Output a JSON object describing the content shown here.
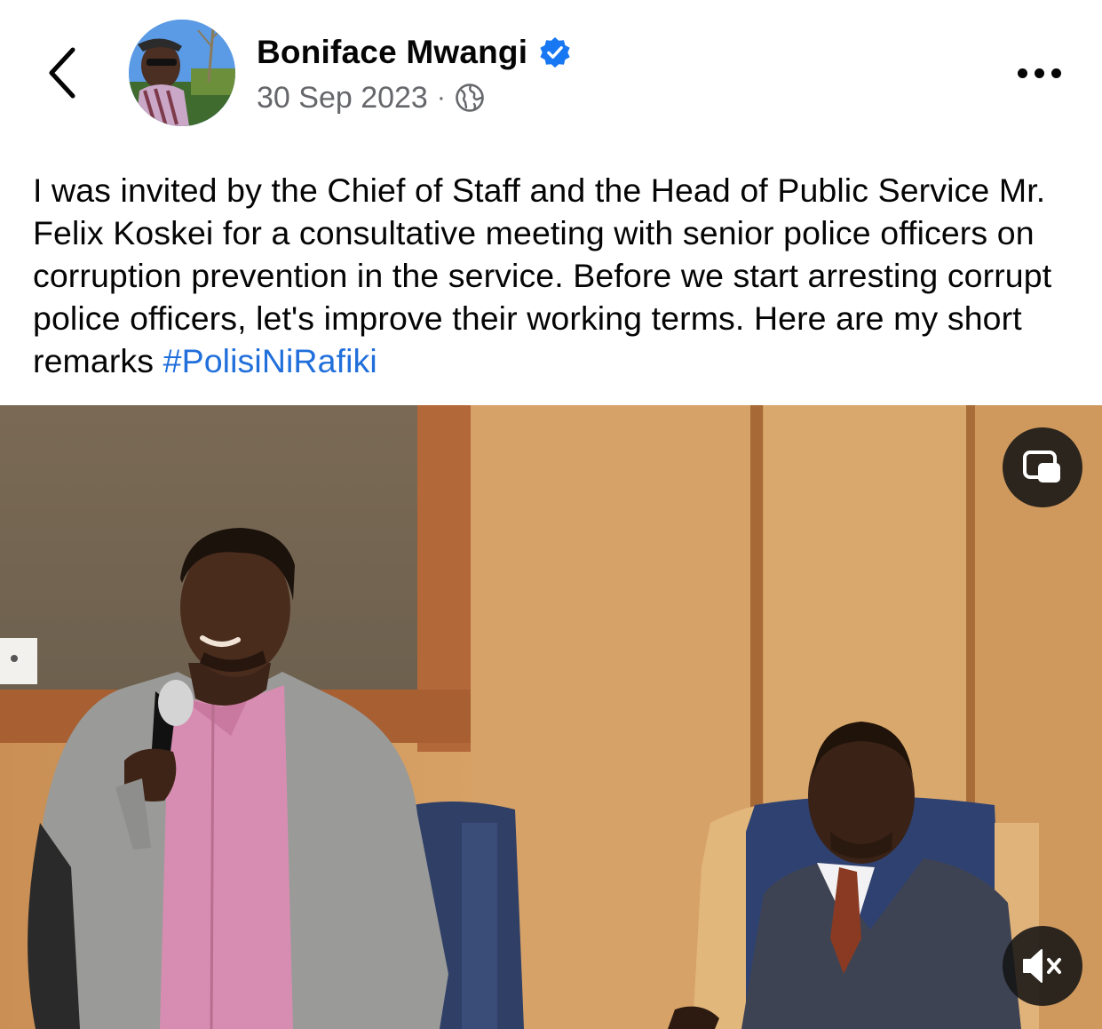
{
  "header": {
    "back_icon": "chevron-left-icon",
    "author_name": "Boniface Mwangi",
    "verified_icon": "verified-badge-icon",
    "date": "30 Sep 2023",
    "separator": "·",
    "audience_icon": "globe-icon",
    "more_icon": "more-horizontal-icon"
  },
  "post": {
    "text": "I was invited by the Chief of Staff and the Head of Public Service Mr. Felix Koskei for a consultative meeting with senior police officers on corruption prevention in the service.  Before we start arresting corrupt police officers, let's improve their working terms. Here are my short remarks ",
    "hashtag": "#PolisiNiRafiki"
  },
  "video": {
    "pip_icon": "picture-in-picture-icon",
    "mute_icon": "speaker-muted-icon"
  },
  "colors": {
    "link": "#216fdb",
    "verified": "#1877f2",
    "meta": "#65676b"
  }
}
